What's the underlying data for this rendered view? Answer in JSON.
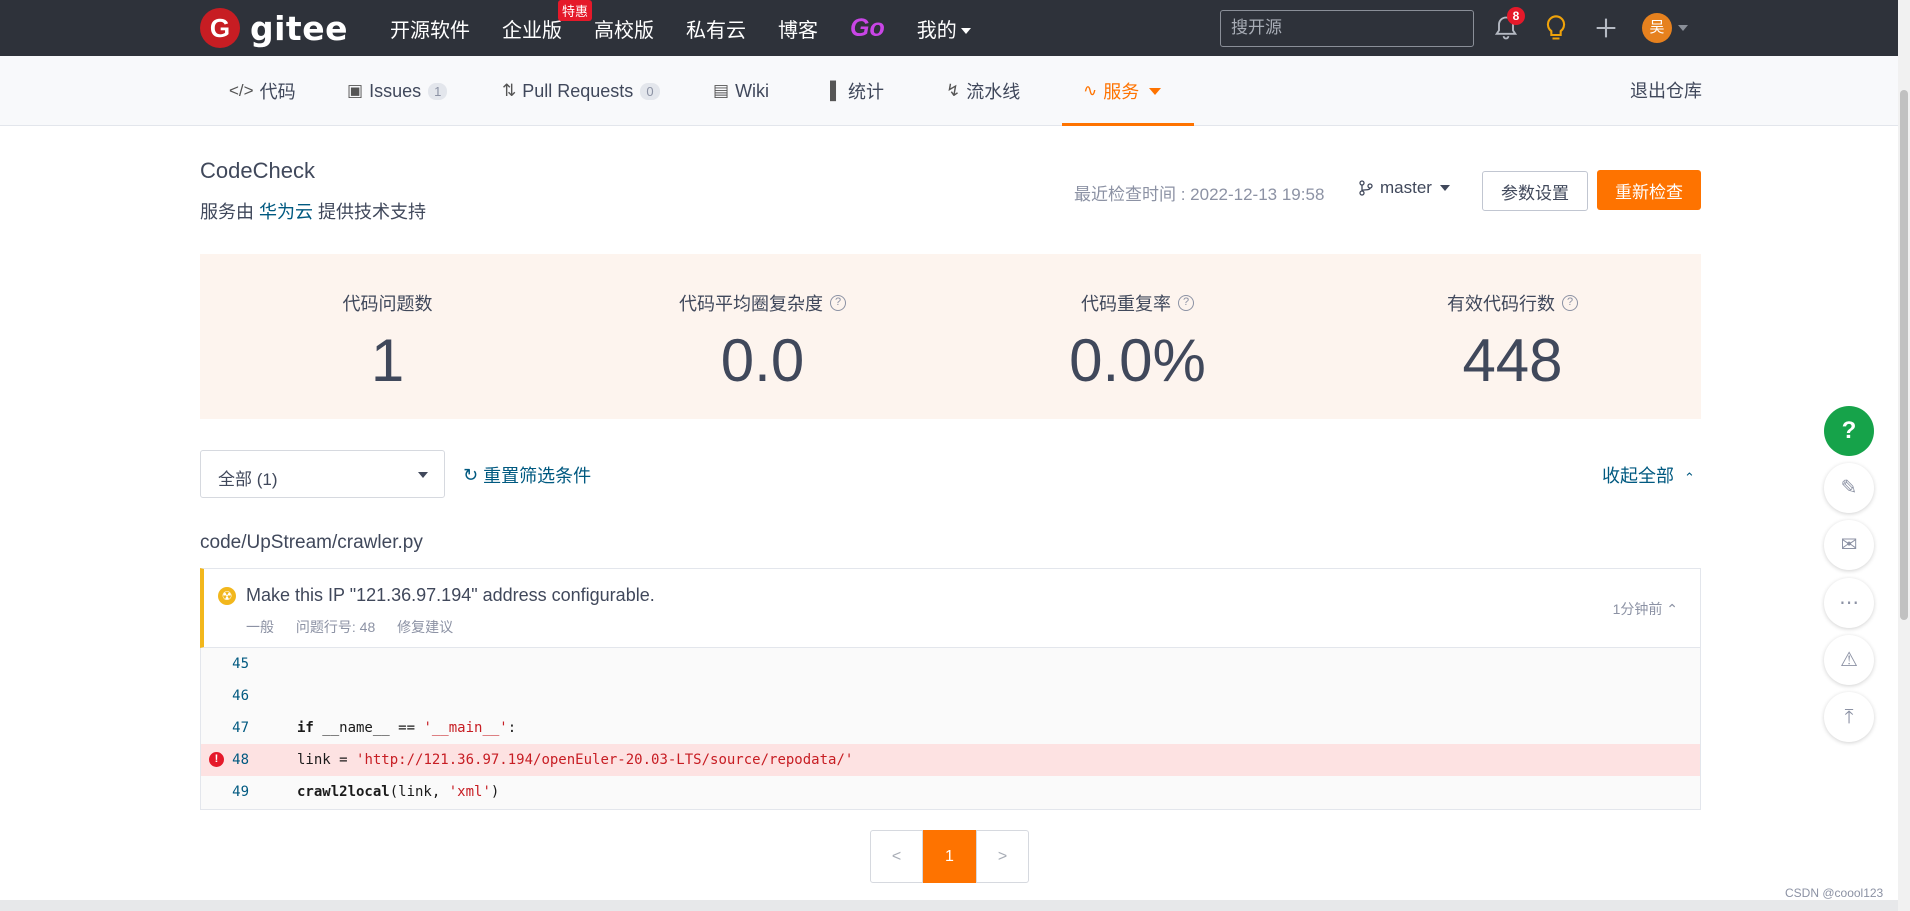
{
  "topnav": {
    "logo_text": "gitee",
    "links": [
      {
        "label": "开源软件"
      },
      {
        "label": "企业版",
        "badge": "特惠"
      },
      {
        "label": "高校版"
      },
      {
        "label": "私有云"
      },
      {
        "label": "博客"
      },
      {
        "label": "Go"
      },
      {
        "label": "我的"
      }
    ],
    "search_placeholder": "搜开源",
    "notification_count": "8",
    "avatar_initial": "吴"
  },
  "tabs": [
    {
      "label": "代码",
      "icon": "code-icon"
    },
    {
      "label": "Issues",
      "count": "1",
      "icon": "issues-icon"
    },
    {
      "label": "Pull Requests",
      "count": "0",
      "icon": "pull-request-icon"
    },
    {
      "label": "Wiki",
      "icon": "wiki-icon"
    },
    {
      "label": "统计",
      "icon": "stats-icon"
    },
    {
      "label": "流水线",
      "icon": "pipeline-icon"
    },
    {
      "label": "服务",
      "icon": "service-icon",
      "active": true
    }
  ],
  "exit_repo": "退出仓库",
  "page": {
    "title": "CodeCheck",
    "subtitle_prefix": "服务由",
    "provider": "华为云",
    "subtitle_suffix": "提供技术支持",
    "last_check": "最近检查时间 : 2022-12-13 19:58",
    "branch": "master",
    "params_button": "参数设置",
    "recheck_button": "重新检查"
  },
  "stats": [
    {
      "label": "代码问题数",
      "value": "1",
      "help": false
    },
    {
      "label": "代码平均圈复杂度",
      "value": "0.0",
      "help": true
    },
    {
      "label": "代码重复率",
      "value": "0.0%",
      "help": true
    },
    {
      "label": "有效代码行数",
      "value": "448",
      "help": true
    }
  ],
  "filters": {
    "select_value": "全部 (1)",
    "reset_label": "重置筛选条件",
    "collapse_all": "收起全部"
  },
  "file": {
    "path": "code/UpStream/crawler.py",
    "issue": {
      "message": "Make this IP \"121.36.97.194\" address configurable.",
      "severity": "一般",
      "line_label": "问题行号: 48",
      "fix_label": "修复建议",
      "time": "1分钟前"
    },
    "code_lines": [
      {
        "num": "45",
        "text": ""
      },
      {
        "num": "46",
        "text": ""
      },
      {
        "num": "47",
        "kw": "if",
        "text": " __name__ == ",
        "str": "'__main__'",
        "tail": ":"
      },
      {
        "num": "48",
        "text": "link = ",
        "str": "'http://121.36.97.194/openEuler-20.03-LTS/source/repodata/'",
        "tail": "",
        "error": true
      },
      {
        "num": "49",
        "kw": "crawl2local",
        "text": "(link, ",
        "str": "'xml'",
        "tail": ")"
      }
    ]
  },
  "pagination": {
    "prev": "<",
    "current": "1",
    "next": ">"
  },
  "watermark": "CSDN @coool123",
  "colors": {
    "accent": "#fe7300",
    "nav_bg": "#2e323a",
    "link": "#005980",
    "warning": "#f2b71c",
    "error_bg": "#fde2e2"
  }
}
